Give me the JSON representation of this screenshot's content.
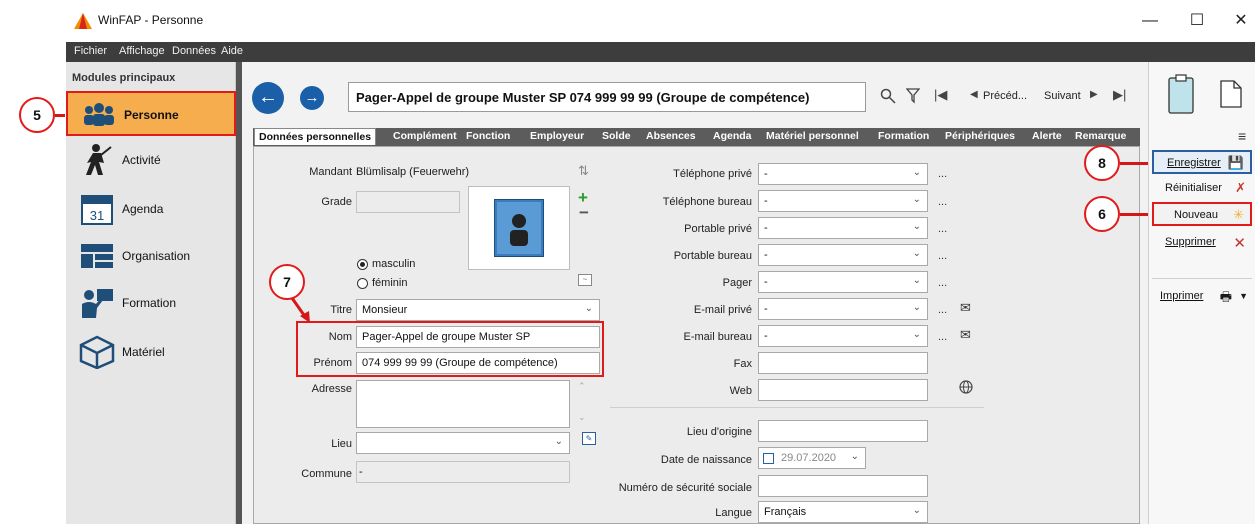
{
  "window": {
    "title": "WinFAP - Personne",
    "minimize": "—",
    "maximize": "☐",
    "close": "✕"
  },
  "menu": [
    "Fichier",
    "Affichage",
    "Données",
    "Aide"
  ],
  "sidebar": {
    "title": "Modules principaux",
    "items": [
      {
        "label": "Personne",
        "icon": "people-icon",
        "active": true
      },
      {
        "label": "Activité",
        "icon": "firefighter-icon"
      },
      {
        "label": "Agenda",
        "icon": "calendar-icon"
      },
      {
        "label": "Organisation",
        "icon": "folder-structure-icon"
      },
      {
        "label": "Formation",
        "icon": "teacher-icon"
      },
      {
        "label": "Matériel",
        "icon": "box-icon"
      }
    ]
  },
  "header": {
    "title": "Pager-Appel de groupe Muster SP 074 999 99 99 (Groupe de compétence)",
    "prev_label": "Précéd...",
    "next_label": "Suivant"
  },
  "tabs": [
    "Données personnelles",
    "Complément",
    "Fonction",
    "Employeur",
    "Solde",
    "Absences",
    "Agenda",
    "Matériel personnel",
    "Formation",
    "Périphériques",
    "Alerte",
    "Remarque"
  ],
  "form": {
    "mandant_label": "Mandant",
    "mandant_value": "Blümlisalp (Feuerwehr)",
    "grade_label": "Grade",
    "grade_value": "",
    "gender_male": "masculin",
    "gender_female": "féminin",
    "titre_label": "Titre",
    "titre_value": "Monsieur",
    "nom_label": "Nom",
    "nom_value": "Pager-Appel de groupe Muster SP",
    "prenom_label": "Prénom",
    "prenom_value": "074 999 99 99 (Groupe de compétence)",
    "adresse_label": "Adresse",
    "lieu_label": "Lieu",
    "commune_label": "Commune",
    "commune_value": "-",
    "contacts": [
      {
        "label": "Téléphone privé",
        "value": "-",
        "mail": false
      },
      {
        "label": "Téléphone bureau",
        "value": "-",
        "mail": false
      },
      {
        "label": "Portable privé",
        "value": "-",
        "mail": false
      },
      {
        "label": "Portable bureau",
        "value": "-",
        "mail": false
      },
      {
        "label": "Pager",
        "value": "-",
        "mail": false
      },
      {
        "label": "E-mail privé",
        "value": "-",
        "mail": true
      },
      {
        "label": "E-mail bureau",
        "value": "-",
        "mail": true
      }
    ],
    "fax_label": "Fax",
    "web_label": "Web",
    "origine_label": "Lieu d'origine",
    "naissance_label": "Date de naissance",
    "naissance_value": "29.07.2020",
    "secu_label": "Numéro de sécurité sociale",
    "langue_label": "Langue",
    "langue_value": "Français",
    "dots": "..."
  },
  "actions": {
    "save": "Enregistrer",
    "reset": "Réinitialiser",
    "new": "Nouveau",
    "delete": "Supprimer",
    "print": "Imprimer"
  },
  "callouts": [
    "5",
    "6",
    "7",
    "8"
  ],
  "colors": {
    "accent": "#1a5fa8",
    "active_item": "#f5ad4d",
    "callout": "#e21a1a",
    "menu_bg": "#3d3d3d"
  }
}
